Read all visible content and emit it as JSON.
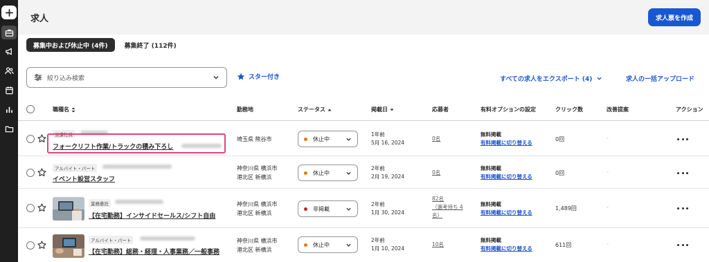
{
  "sidebar": {
    "items": [
      {
        "icon": "plus-icon"
      },
      {
        "icon": "briefcase-icon",
        "active": true
      },
      {
        "icon": "megaphone-icon"
      },
      {
        "icon": "people-icon"
      },
      {
        "icon": "calendar-icon"
      },
      {
        "icon": "bar-chart-icon"
      },
      {
        "icon": "folder-icon"
      }
    ]
  },
  "header": {
    "title": "求人",
    "create_button": "求人票を作成"
  },
  "tabs": [
    {
      "label": "募集中および休止中 (4件)",
      "active": true
    },
    {
      "label": "募集終了 (112件)",
      "active": false
    }
  ],
  "toolbar": {
    "filter_placeholder": "絞り込み検索",
    "starred_label": "スター付き",
    "export_label": "すべての求人をエクスポート (4)",
    "upload_label": "求人の一括アップロード"
  },
  "table": {
    "columns": {
      "title": "職種名",
      "location": "勤務地",
      "status": "ステータス",
      "posted": "掲載日",
      "applicants": "応募者",
      "paid_option": "有料オプションの設定",
      "clicks": "クリック数",
      "improvement": "改善提案",
      "action": "アクション"
    },
    "rows": [
      {
        "employment_type": "派遣社員",
        "title": "フォークリフト作業/トラックの積み下ろし",
        "location_1": "埼玉県 熊谷市",
        "location_2": "",
        "status": "休止中",
        "status_color": "#e07b00",
        "posted_rel": "1年前",
        "posted_date": "5月 16, 2024",
        "applicants": "0名",
        "applicants_note": "",
        "paid_status": "無料掲載",
        "paid_switch": "有料掲載に切り替える",
        "clicks": "0回",
        "improvement": "-"
      },
      {
        "employment_type": "アルバイト・パート",
        "title": "イベント設営スタッフ",
        "location_1": "神奈川県 横浜市",
        "location_2": "港北区 新横浜",
        "status": "休止中",
        "status_color": "#e07b00",
        "posted_rel": "2年前",
        "posted_date": "2月 19, 2024",
        "applicants": "0名",
        "applicants_note": "",
        "paid_status": "無料掲載",
        "paid_switch": "有料掲載に切り替える",
        "clicks": "0回",
        "improvement": "-"
      },
      {
        "employment_type": "業務委託",
        "title": "【在宅勤務】インサイドセールス/シフト自由",
        "location_1": "神奈川県 横浜市",
        "location_2": "港北区 新横浜",
        "status": "非掲載",
        "status_color": "#c0272d",
        "posted_rel": "2年前",
        "posted_date": "1月 30, 2024",
        "applicants": "82名",
        "applicants_note_1": "（選考待ち 4",
        "applicants_note_2": "名）",
        "paid_status": "無料掲載",
        "paid_switch": "有料掲載に切り替える",
        "clicks": "1,489回",
        "improvement": "-"
      },
      {
        "employment_type": "アルバイト・パート",
        "title": "【在宅勤務】総務・経理・人事業務／一般事務",
        "location_1": "神奈川県 横浜市",
        "location_2": "港北区 新横浜",
        "status": "休止中",
        "status_color": "#e07b00",
        "posted_rel": "2年前",
        "posted_date": "1月 10, 2024",
        "applicants": "10名",
        "applicants_note": "",
        "paid_status": "無料掲載",
        "paid_switch": "有料掲載に切り替える",
        "clicks": "611回",
        "improvement": "-"
      }
    ]
  },
  "colors": {
    "accent": "#1957d2",
    "sidebar_bg": "#1f1f1f",
    "highlight": "#e0447c"
  }
}
